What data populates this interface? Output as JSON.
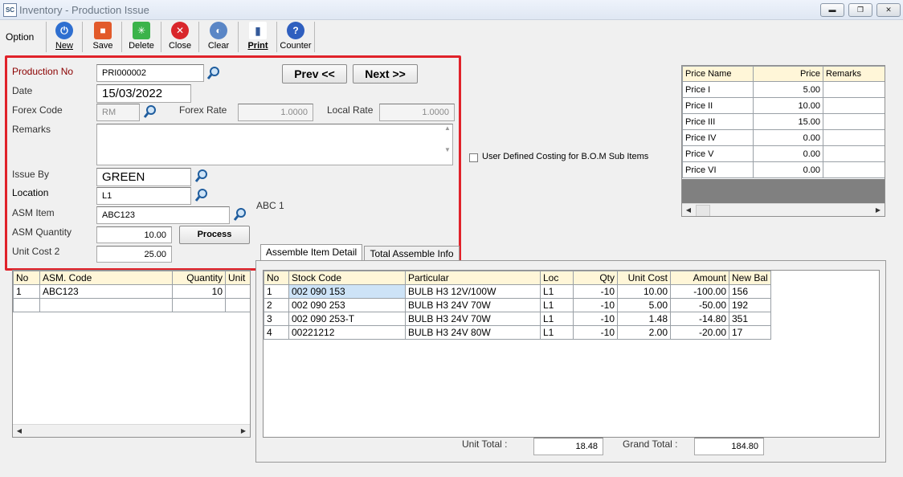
{
  "window": {
    "title": "Inventory - Production Issue",
    "app_icon_text": "SC"
  },
  "toolbar": {
    "option_label": "Option",
    "buttons": [
      {
        "label": "New",
        "icon": "power-icon",
        "color": "#2f6fd0"
      },
      {
        "label": "Save",
        "icon": "save-icon",
        "color": "#e25a2a"
      },
      {
        "label": "Delete",
        "icon": "delete-icon",
        "color": "#3bb34a"
      },
      {
        "label": "Close",
        "icon": "close-circle-icon",
        "color": "#d9262b"
      },
      {
        "label": "Clear",
        "icon": "clear-icon",
        "color": "#5a86c6"
      },
      {
        "label": "Print",
        "icon": "print-icon",
        "color": "#345a9a"
      },
      {
        "label": "Counter",
        "icon": "help-icon",
        "color": "#2f5fbf"
      }
    ]
  },
  "form": {
    "production_no_label": "Production No",
    "production_no": "PRI000002",
    "date_label": "Date",
    "date": "15/03/2022",
    "forex_code_label": "Forex Code",
    "forex_code": "RM",
    "forex_rate_label": "Forex Rate",
    "forex_rate": "1.0000",
    "local_rate_label": "Local Rate",
    "local_rate": "1.0000",
    "remarks_label": "Remarks",
    "remarks": "",
    "issue_by_label": "Issue By",
    "issue_by": "GREEN",
    "location_label": "Location",
    "location": "L1",
    "asm_item_label": "ASM Item",
    "asm_item": "ABC123",
    "asm_item_desc": "ABC 1",
    "asm_quantity_label": "ASM Quantity",
    "asm_quantity": "10.00",
    "unit_cost_label": "Unit Cost 2",
    "unit_cost": "25.00",
    "prev_label": "Prev <<",
    "next_label": "Next >>",
    "process_label": "Process",
    "user_defined_label": "User Defined Costing for B.O.M Sub Items"
  },
  "price_table": {
    "headers": [
      "Price Name",
      "Price",
      "Remarks"
    ],
    "rows": [
      [
        "Price I",
        "5.00",
        ""
      ],
      [
        "Price II",
        "10.00",
        ""
      ],
      [
        "Price III",
        "15.00",
        ""
      ],
      [
        "Price IV",
        "0.00",
        ""
      ],
      [
        "Price V",
        "0.00",
        ""
      ],
      [
        "Price VI",
        "0.00",
        ""
      ]
    ]
  },
  "asm_table": {
    "headers": [
      "No",
      "ASM. Code",
      "Quantity",
      "Unit"
    ],
    "rows": [
      [
        "1",
        "ABC123",
        "10",
        ""
      ],
      [
        "",
        "",
        "",
        ""
      ]
    ]
  },
  "tabs": [
    "Assemble Item Detail",
    "Total Assemble Info"
  ],
  "detail_table": {
    "headers": [
      "No",
      "Stock Code",
      "Particular",
      "Loc",
      "Qty",
      "Unit Cost",
      "Amount",
      "New Bal"
    ],
    "rows": [
      [
        "1",
        "002 090 153",
        "BULB H3 12V/100W",
        "L1",
        "-10",
        "10.00",
        "-100.00",
        "156"
      ],
      [
        "2",
        "002 090 253",
        "BULB H3 24V 70W",
        "L1",
        "-10",
        "5.00",
        "-50.00",
        "192"
      ],
      [
        "3",
        "002 090 253-T",
        "BULB H3 24V 70W",
        "L1",
        "-10",
        "1.48",
        "-14.80",
        "351"
      ],
      [
        "4",
        "00221212",
        "BULB H3 24V 80W",
        "L1",
        "-10",
        "2.00",
        "-20.00",
        "17"
      ]
    ]
  },
  "totals": {
    "unit_total_label": "Unit Total :",
    "unit_total": "18.48",
    "grand_total_label": "Grand Total :",
    "grand_total": "184.80"
  }
}
